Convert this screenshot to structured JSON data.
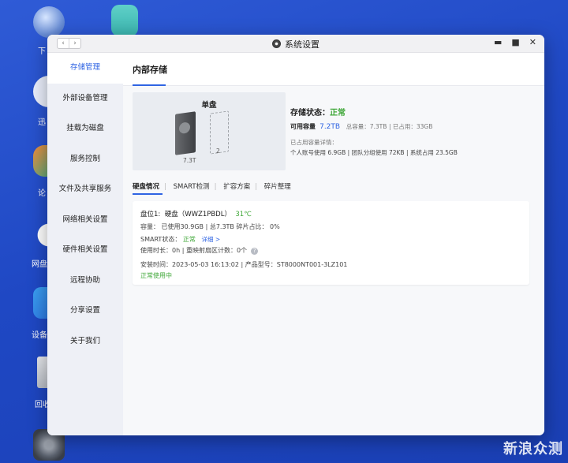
{
  "desktop": {
    "icons": [
      {
        "label": "下"
      },
      {
        "label": ""
      },
      {
        "label": "迅"
      },
      {
        "label": "论"
      },
      {
        "label": "网盘"
      },
      {
        "label": "设备"
      },
      {
        "label": "回收"
      },
      {
        "label": ""
      }
    ],
    "watermark": "新浪众测"
  },
  "window": {
    "title": "系统设置",
    "nav_back": "‹",
    "nav_forward": "›",
    "ctrl_min": "▬",
    "ctrl_max": "■",
    "ctrl_close": "✕"
  },
  "sidebar": {
    "items": [
      {
        "label": "存储管理"
      },
      {
        "label": "外部设备管理"
      },
      {
        "label": "挂载为磁盘"
      },
      {
        "label": "服务控制"
      },
      {
        "label": "文件及共享服务"
      },
      {
        "label": "网络相关设置"
      },
      {
        "label": "硬件相关设置"
      },
      {
        "label": "远程协助"
      },
      {
        "label": "分享设置"
      },
      {
        "label": "关于我们"
      }
    ]
  },
  "main": {
    "title": "内部存储",
    "disk_box": {
      "caption": "单盘",
      "disk1_size": "7.3T",
      "disk2_slot": "2"
    },
    "status": {
      "label": "存储状态：",
      "value": "正常",
      "avail_label": "可用容量",
      "avail_value": "7.2TB",
      "total": "总容量：7.3TB",
      "used": "已占用：33GB",
      "detail_heading": "已占用容量详情：",
      "detail": "个人账号使用 6.9GB | 团队分组使用 72KB | 系统占用 23.5GB"
    },
    "tabs": [
      "硬盘情况",
      "SMART检测",
      "扩容方案",
      "碎片整理"
    ],
    "card": {
      "slot": "盘位1:",
      "name": "硬盘（WWZ1PBDL）",
      "temp": "31℃",
      "capacity": "容量：  已使用30.9GB | 总7.3TB   碎片占比：  0%",
      "smart_label": "SMART状态：",
      "smart_value": "正常",
      "smart_link": "详细 >",
      "usage": "使用时长：0h | 重映射扇区计数：0个",
      "qmark": "?",
      "install": "安装时间：2023-05-03 16:13:02 | 产品型号：ST8000NT001-3LZ101",
      "health": "正常使用中"
    }
  }
}
